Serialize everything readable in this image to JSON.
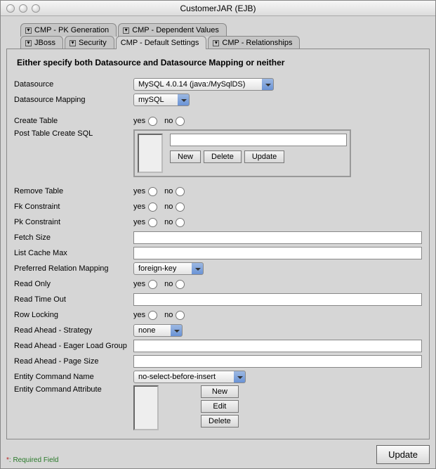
{
  "window": {
    "title": "CustomerJAR (EJB)"
  },
  "tabs_row1": [
    {
      "label": "CMP - PK Generation"
    },
    {
      "label": "CMP - Dependent Values"
    }
  ],
  "tabs_row2": [
    {
      "label": "JBoss"
    },
    {
      "label": "Security"
    },
    {
      "label": "CMP - Default Settings"
    },
    {
      "label": "CMP - Relationships"
    }
  ],
  "heading": "Either specify both Datasource and Datasource Mapping or neither",
  "labels": {
    "datasource": "Datasource",
    "datasource_mapping": "Datasource Mapping",
    "create_table": "Create Table",
    "post_table_sql": "Post Table Create SQL",
    "remove_table": "Remove Table",
    "fk_constraint": "Fk Constraint",
    "pk_constraint": "Pk Constraint",
    "fetch_size": "Fetch Size",
    "list_cache_max": "List Cache Max",
    "pref_rel_map": "Preferred Relation Mapping",
    "read_only": "Read Only",
    "read_timeout": "Read Time Out",
    "row_locking": "Row Locking",
    "read_ahead_strategy": "Read Ahead - Strategy",
    "read_ahead_eager": "Read Ahead - Eager Load Group",
    "read_ahead_page": "Read Ahead - Page Size",
    "entity_cmd_name": "Entity Command Name",
    "entity_cmd_attr": "Entity Command Attribute"
  },
  "values": {
    "datasource": "MySQL 4.0.14 (java:/MySqlDS)",
    "datasource_mapping": "mySQL",
    "fetch_size": "",
    "list_cache_max": "",
    "pref_rel_map": "foreign-key",
    "read_timeout": "",
    "read_ahead_strategy": "none",
    "read_ahead_eager": "",
    "read_ahead_page": "",
    "entity_cmd_name": "no-select-before-insert",
    "sql_input": ""
  },
  "radios": {
    "yes": "yes",
    "no": "no"
  },
  "buttons": {
    "new": "New",
    "delete": "Delete",
    "update": "Update",
    "edit": "Edit",
    "update_big": "Update"
  },
  "footer": {
    "star": "*",
    "req": ": Required Field"
  }
}
